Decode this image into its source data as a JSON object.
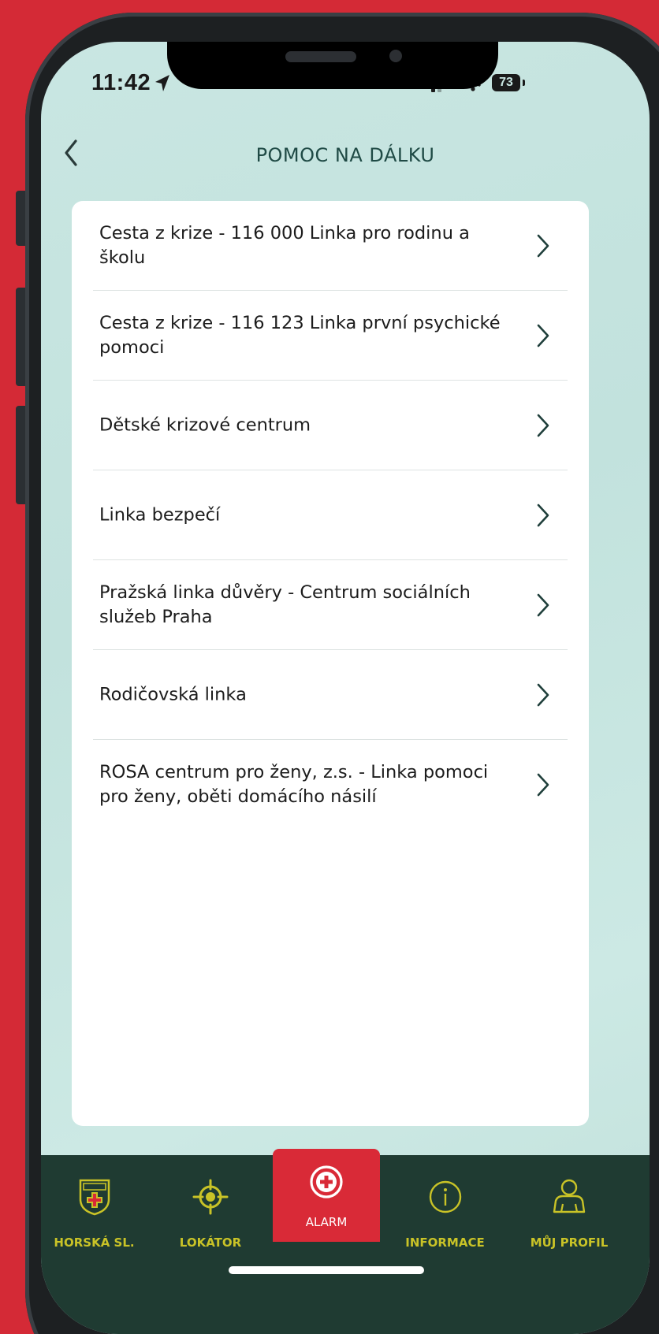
{
  "status_bar": {
    "time": "11:42",
    "battery": "73"
  },
  "header": {
    "title": "POMOC NA DÁLKU",
    "back_icon": "chevron-left-icon"
  },
  "list": {
    "items": [
      {
        "label": "Cesta z krize - 116 000 Linka pro rodinu a školu"
      },
      {
        "label": "Cesta z krize - 116 123 Linka první psychické pomoci"
      },
      {
        "label": "Dětské krizové centrum"
      },
      {
        "label": "Linka bezpečí"
      },
      {
        "label": "Pražská linka důvěry - Centrum sociálních služeb Praha"
      },
      {
        "label": "Rodičovská linka"
      },
      {
        "label": "ROSA centrum pro ženy, z.s. - Linka pomoci pro ženy, oběti domácího násilí"
      }
    ]
  },
  "tabbar": {
    "tabs": [
      {
        "label": "HORSKÁ SL.",
        "icon": "mountain-rescue-badge-icon"
      },
      {
        "label": "LOKÁTOR",
        "icon": "crosshair-target-icon"
      },
      {
        "label": "ALARM",
        "icon": "plus-circle-icon",
        "active": true
      },
      {
        "label": "INFORMACE",
        "icon": "info-circle-icon"
      },
      {
        "label": "MŮJ PROFIL",
        "icon": "user-profile-icon"
      }
    ]
  },
  "colors": {
    "background_red": "#d42a36",
    "screen_mint": "#c9e6e2",
    "tabbar_green": "#1f3b32",
    "tab_label_yellow": "#c9c327",
    "title_green": "#1f4a45",
    "alarm_red": "#d92a37"
  }
}
